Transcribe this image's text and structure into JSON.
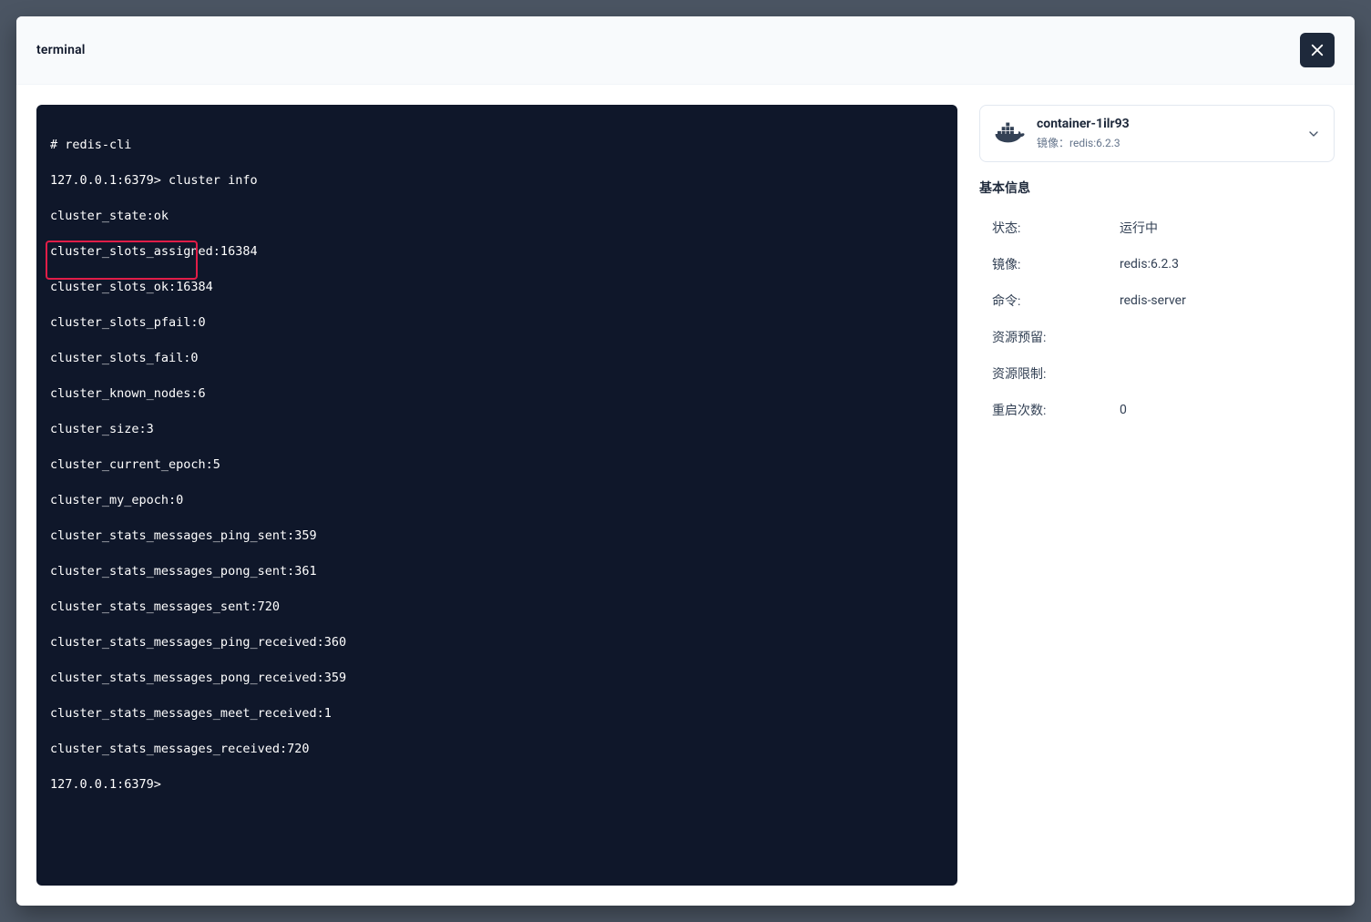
{
  "modal": {
    "title": "terminal"
  },
  "terminal": {
    "lines": {
      "l0": "# redis-cli",
      "l1": "127.0.0.1:6379> cluster info",
      "l2": "cluster_state:ok",
      "l3": "cluster_slots_assigned:16384",
      "l4": "cluster_slots_ok:16384",
      "l5": "cluster_slots_pfail:0",
      "l6": "cluster_slots_fail:0",
      "l7": "cluster_known_nodes:6",
      "l8": "cluster_size:3",
      "l9": "cluster_current_epoch:5",
      "l10": "cluster_my_epoch:0",
      "l11": "cluster_stats_messages_ping_sent:359",
      "l12": "cluster_stats_messages_pong_sent:361",
      "l13": "cluster_stats_messages_sent:720",
      "l14": "cluster_stats_messages_ping_received:360",
      "l15": "cluster_stats_messages_pong_received:359",
      "l16": "cluster_stats_messages_meet_received:1",
      "l17": "cluster_stats_messages_received:720",
      "l18": "127.0.0.1:6379>"
    }
  },
  "container": {
    "name": "container-1ilr93",
    "image_prefix": "镜像：",
    "image": "redis:6.2.3"
  },
  "info": {
    "section_title": "基本信息",
    "rows": {
      "status": {
        "label": "状态:",
        "value": "运行中"
      },
      "image": {
        "label": "镜像:",
        "value": "redis:6.2.3"
      },
      "command": {
        "label": "命令:",
        "value": "redis-server"
      },
      "reserved": {
        "label": "资源预留:",
        "value": ""
      },
      "limit": {
        "label": "资源限制:",
        "value": ""
      },
      "restarts": {
        "label": "重启次数:",
        "value": "0"
      }
    }
  }
}
